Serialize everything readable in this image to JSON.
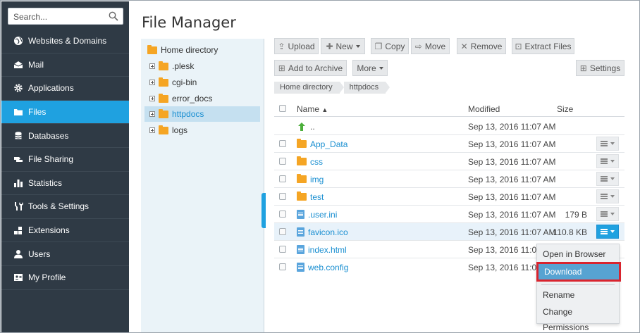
{
  "sidebar": {
    "search_placeholder": "Search...",
    "items": [
      {
        "label": "Websites & Domains",
        "icon": "globe-icon"
      },
      {
        "label": "Mail",
        "icon": "envelope-icon"
      },
      {
        "label": "Applications",
        "icon": "gear-icon"
      },
      {
        "label": "Files",
        "icon": "folder-icon",
        "active": true
      },
      {
        "label": "Databases",
        "icon": "database-icon"
      },
      {
        "label": "File Sharing",
        "icon": "share-icon"
      },
      {
        "label": "Statistics",
        "icon": "bar-chart-icon"
      },
      {
        "label": "Tools & Settings",
        "icon": "tools-icon"
      },
      {
        "label": "Extensions",
        "icon": "blocks-icon"
      },
      {
        "label": "Users",
        "icon": "user-icon"
      },
      {
        "label": "My Profile",
        "icon": "profile-card-icon"
      }
    ]
  },
  "page": {
    "title": "File Manager"
  },
  "tree": {
    "root": "Home directory",
    "items": [
      ".plesk",
      "cgi-bin",
      "error_docs",
      "httpdocs",
      "logs"
    ]
  },
  "toolbar": {
    "upload": "Upload",
    "new": "New",
    "copy": "Copy",
    "move": "Move",
    "remove": "Remove",
    "extract": "Extract Files",
    "archive": "Add to Archive",
    "more": "More",
    "settings": "Settings"
  },
  "breadcrumb": [
    "Home directory",
    "httpdocs"
  ],
  "table": {
    "headers": {
      "name": "Name",
      "modified": "Modified",
      "size": "Size"
    },
    "parent": {
      "name": "..",
      "modified": "Sep 13, 2016 11:07 AM"
    },
    "rows": [
      {
        "name": "App_Data",
        "modified": "Sep 13, 2016 11:07 AM",
        "size": "",
        "type": "folder"
      },
      {
        "name": "css",
        "modified": "Sep 13, 2016 11:07 AM",
        "size": "",
        "type": "folder"
      },
      {
        "name": "img",
        "modified": "Sep 13, 2016 11:07 AM",
        "size": "",
        "type": "folder"
      },
      {
        "name": "test",
        "modified": "Sep 13, 2016 11:07 AM",
        "size": "",
        "type": "folder"
      },
      {
        "name": ".user.ini",
        "modified": "Sep 13, 2016 11:07 AM",
        "size": "179 B",
        "type": "file"
      },
      {
        "name": "favicon.ico",
        "modified": "Sep 13, 2016 11:07 AM",
        "size": "110.8 KB",
        "type": "file"
      },
      {
        "name": "index.html",
        "modified": "Sep 13, 2016 11:07 A",
        "size": "",
        "type": "file"
      },
      {
        "name": "web.config",
        "modified": "Sep 13, 2016 11:07 A",
        "size": "",
        "type": "file"
      }
    ]
  },
  "context_menu": {
    "open": "Open in Browser",
    "download": "Download",
    "rename": "Rename",
    "permissions": "Change Permissions"
  },
  "colors": {
    "sidebar": "#2f3a45",
    "accent": "#1fa1e0",
    "folder": "#f5a524",
    "highlight_border": "#d9242e"
  }
}
